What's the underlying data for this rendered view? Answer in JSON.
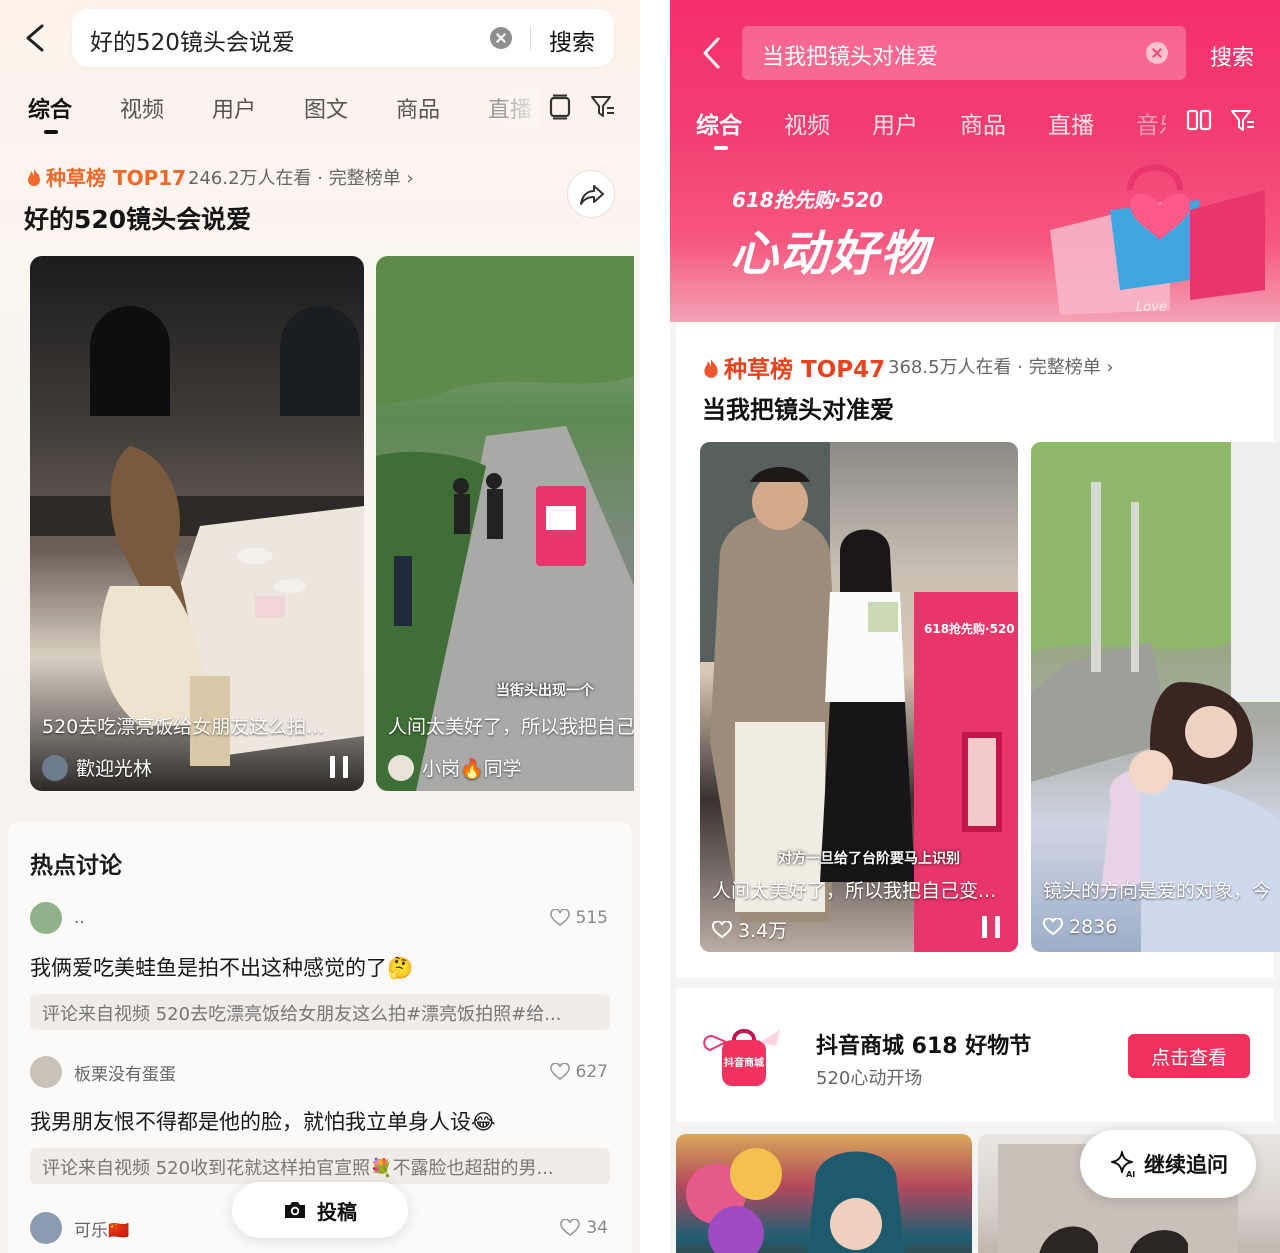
{
  "left": {
    "search": {
      "query": "好的520镜头会说爱",
      "button": "搜索"
    },
    "tabs": [
      {
        "label": "综合",
        "active": true
      },
      {
        "label": "视频"
      },
      {
        "label": "用户"
      },
      {
        "label": "图文"
      },
      {
        "label": "商品"
      },
      {
        "label": "直播"
      }
    ],
    "ranking": {
      "badge": "种草榜 TOP17",
      "meta": "246.2万人在看 · 完整榜单 ›"
    },
    "topic_title": "好的520镜头会说爱",
    "videos": [
      {
        "caption": "520去吃漂亮饭给女朋友这么拍...",
        "author": "歡迎光林"
      },
      {
        "caption": "人间太美好了，所以我把自己",
        "author": "小岗🔥同学",
        "overlay": "当街头出现一个"
      }
    ],
    "hot": {
      "heading": "热点讨论",
      "comments": [
        {
          "user": "..",
          "likes": "515",
          "text": "我俩爱吃美蛙鱼是拍不出这种感觉的了🤔",
          "source": "评论来自视频 520去吃漂亮饭给女朋友这么拍#漂亮饭拍照#给..."
        },
        {
          "user": "板栗没有蛋蛋",
          "likes": "627",
          "text": "我男朋友恨不得都是他的脸，就怕我立单身人设😂",
          "source": "评论来自视频 520收到花就这样拍官宣照💐不露脸也超甜的男..."
        },
        {
          "user": "可乐🇨🇳",
          "likes": "34"
        }
      ]
    },
    "post_button": "投稿"
  },
  "right": {
    "search": {
      "query": "当我把镜头对准爱",
      "button": "搜索"
    },
    "tabs": [
      {
        "label": "综合",
        "active": true
      },
      {
        "label": "视频"
      },
      {
        "label": "用户"
      },
      {
        "label": "商品"
      },
      {
        "label": "直播"
      },
      {
        "label": "音乐"
      }
    ],
    "promo": {
      "subtitle": "618抢先购·520",
      "title": "心动好物",
      "watermark": "Love"
    },
    "ranking": {
      "badge": "种草榜 TOP47",
      "meta": "368.5万人在看 · 完整榜单 ›"
    },
    "topic_title": "当我把镜头对准爱",
    "videos": [
      {
        "caption": "人间太美好了，所以我把自己变...",
        "likes": "3.4万",
        "overlay": "对方一旦给了台阶要马上识别",
        "door_text": "618抢先购·520"
      },
      {
        "caption": "镜头的方向是爱的对象，今",
        "likes": "2836"
      }
    ],
    "mall": {
      "title": "抖音商城 618 好物节",
      "subtitle": "520心动开场",
      "button": "点击查看",
      "logo_text": "抖音商城"
    },
    "follow_button": "继续追问"
  },
  "colors": {
    "brand_pink": "#f2305e",
    "rank_orange": "#ef6a2a"
  },
  "icons": [
    "back-arrow-icon",
    "clear-icon",
    "tablet-icon",
    "filter-icon",
    "fire-icon",
    "share-icon",
    "pause-icon",
    "heart-icon",
    "camera-icon",
    "ai-sparkle-icon",
    "dual-column-icon"
  ]
}
